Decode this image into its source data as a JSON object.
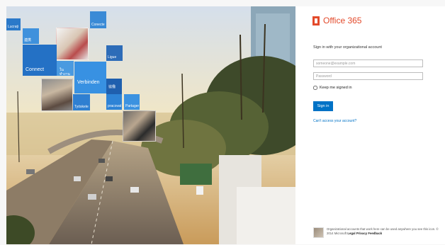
{
  "tiles": {
    "t1": "Lucrați",
    "t2": "連携",
    "t3": "Connect",
    "t4": "ในทำงาน",
    "t5": "Conecte",
    "t6": "Ligue",
    "t7": "Verbinden",
    "t8": "協働",
    "t9": "Työskele",
    "t10": "pracovat",
    "t11": "Partager"
  },
  "brand": {
    "name": "Office 365"
  },
  "form": {
    "prompt": "Sign in with your organizational account",
    "username_placeholder": "someone@example.com",
    "password_placeholder": "Password",
    "keep_label": "Keep me signed in",
    "signin_label": "Sign in",
    "cant_access": "Can't access your account?"
  },
  "footer": {
    "text": "Organizational accounts that work here can be used anywhere you see this icon. © 2014 Microsoft",
    "legal": "Legal",
    "privacy": "Privacy",
    "feedback": "Feedback"
  },
  "colors": {
    "office_red": "#e34a2b",
    "tile_blue": "#2f7fd1",
    "button_blue": "#0072c6"
  }
}
